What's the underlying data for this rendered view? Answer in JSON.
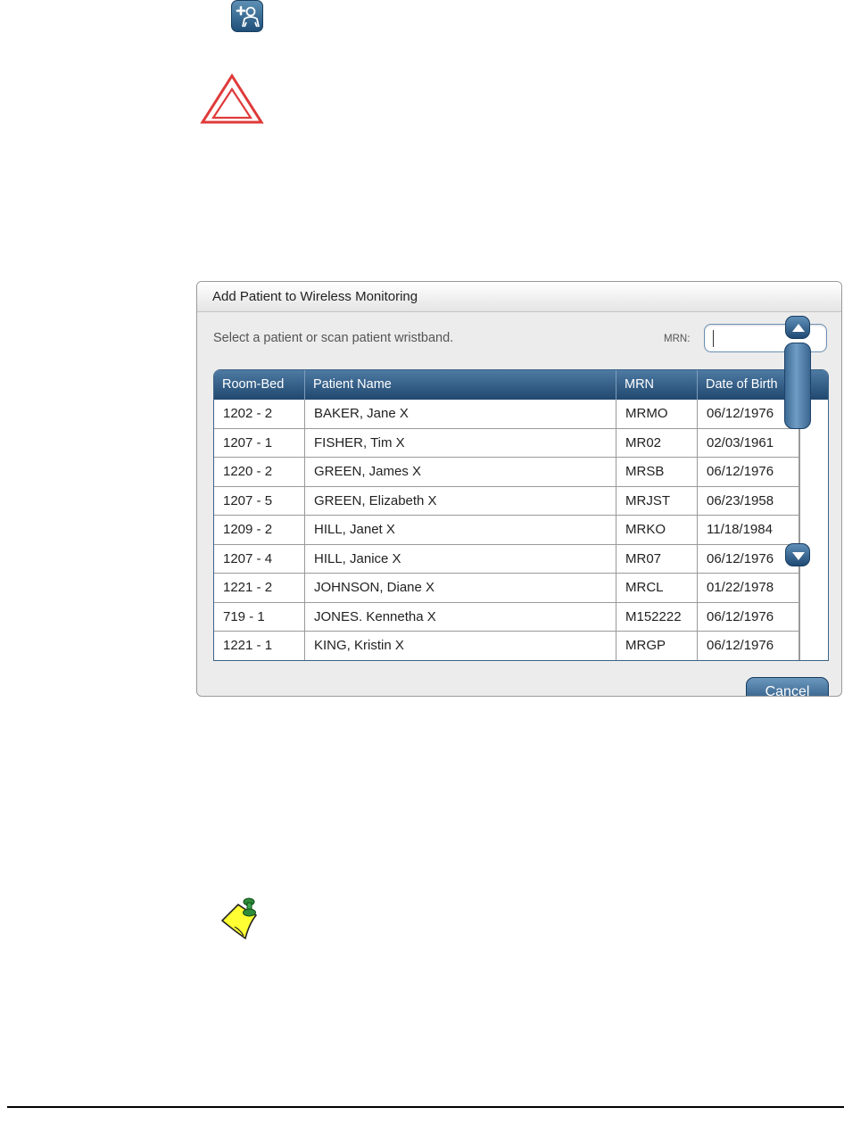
{
  "icons": {
    "add_patient": "add-patient-icon",
    "warning": "warning-triangle-icon",
    "note": "note-pin-icon"
  },
  "colors": {
    "header_blue": "#2c5680",
    "button_blue": "#24517c",
    "warning_red": "#e03a3a",
    "note_yellow": "#ffff33"
  },
  "dialog": {
    "title": "Add Patient to Wireless Monitoring",
    "instruction": "Select a patient or scan patient wristband.",
    "mrn_label": "MRN:",
    "mrn_value": "",
    "cancel_label": "Cancel",
    "table": {
      "headers": [
        "Room-Bed",
        "Patient Name",
        "MRN",
        "Date of Birth"
      ],
      "rows": [
        [
          "1202 - 2",
          "BAKER, Jane X",
          "MRMO",
          "06/12/1976"
        ],
        [
          "1207 - 1",
          "FISHER, Tim X",
          "MR02",
          "02/03/1961"
        ],
        [
          "1220 - 2",
          "GREEN, James X",
          "MRSB",
          "06/12/1976"
        ],
        [
          "1207 - 5",
          "GREEN, Elizabeth X",
          "MRJST",
          "06/23/1958"
        ],
        [
          "1209 - 2",
          "HILL, Janet X",
          "MRKO",
          "11/18/1984"
        ],
        [
          "1207 - 4",
          "HILL, Janice X",
          "MR07",
          "06/12/1976"
        ],
        [
          "1221 - 2",
          "JOHNSON, Diane X",
          "MRCL",
          "01/22/1978"
        ],
        [
          "719 - 1",
          "JONES. Kennetha X",
          "M152222",
          "06/12/1976"
        ],
        [
          "1221 - 1",
          "KING, Kristin X",
          "MRGP",
          "06/12/1976"
        ]
      ]
    }
  }
}
